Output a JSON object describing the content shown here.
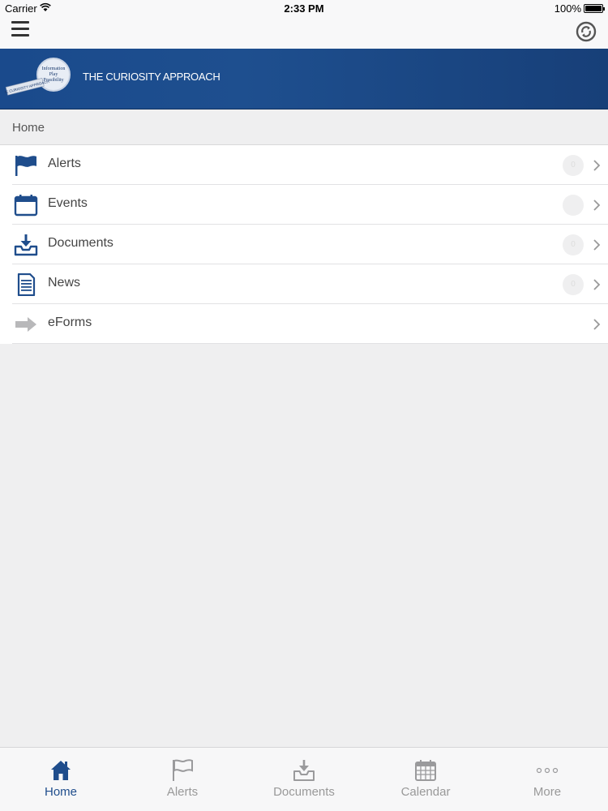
{
  "status_bar": {
    "carrier": "Carrier",
    "time": "2:33 PM",
    "battery": "100%"
  },
  "banner": {
    "title": "THE CURIOSITY APPROACH",
    "logo_text": [
      "Information",
      "Play",
      "Possibility"
    ],
    "logo_ribbon": "THE CURIOSITY APPROACH"
  },
  "breadcrumb": "Home",
  "menu": {
    "items": [
      {
        "label": "Alerts",
        "icon": "flag-icon",
        "badge": "0"
      },
      {
        "label": "Events",
        "icon": "calendar-icon",
        "badge": ""
      },
      {
        "label": "Documents",
        "icon": "inbox-download-icon",
        "badge": "0"
      },
      {
        "label": "News",
        "icon": "document-icon",
        "badge": "0"
      },
      {
        "label": "eForms",
        "icon": "arrow-right-icon"
      }
    ]
  },
  "tabs": [
    {
      "label": "Home",
      "icon": "home-icon",
      "active": true
    },
    {
      "label": "Alerts",
      "icon": "flag-icon",
      "active": false
    },
    {
      "label": "Documents",
      "icon": "inbox-download-icon",
      "active": false
    },
    {
      "label": "Calendar",
      "icon": "calendar-grid-icon",
      "active": false
    },
    {
      "label": "More",
      "icon": "more-dots-icon",
      "active": false
    }
  ],
  "colors": {
    "accent": "#1f4d8c",
    "banner": "#1a4a8c",
    "background": "#efeff0",
    "inactive_tab": "#999999"
  }
}
